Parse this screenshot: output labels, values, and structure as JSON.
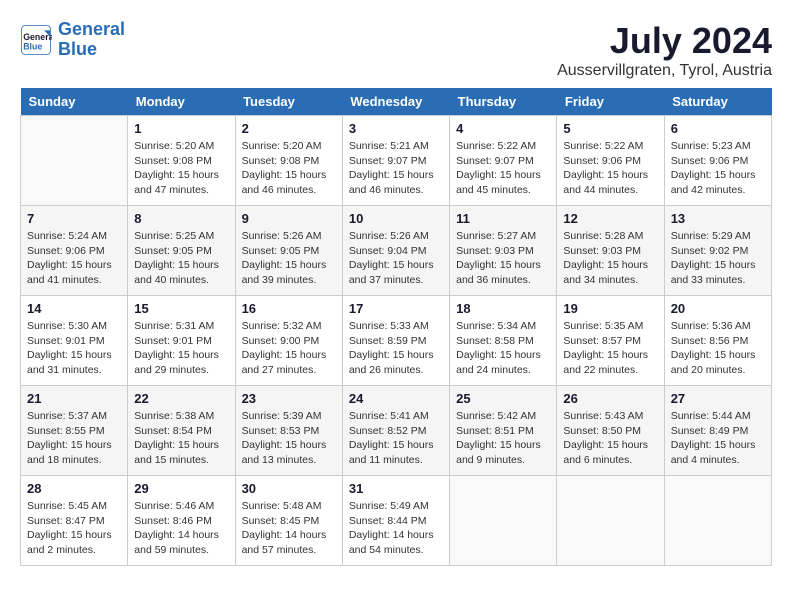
{
  "header": {
    "logo_line1": "General",
    "logo_line2": "Blue",
    "month": "July 2024",
    "location": "Ausservillgraten, Tyrol, Austria"
  },
  "weekdays": [
    "Sunday",
    "Monday",
    "Tuesday",
    "Wednesday",
    "Thursday",
    "Friday",
    "Saturday"
  ],
  "weeks": [
    [
      {
        "day": "",
        "info": ""
      },
      {
        "day": "1",
        "info": "Sunrise: 5:20 AM\nSunset: 9:08 PM\nDaylight: 15 hours\nand 47 minutes."
      },
      {
        "day": "2",
        "info": "Sunrise: 5:20 AM\nSunset: 9:08 PM\nDaylight: 15 hours\nand 46 minutes."
      },
      {
        "day": "3",
        "info": "Sunrise: 5:21 AM\nSunset: 9:07 PM\nDaylight: 15 hours\nand 46 minutes."
      },
      {
        "day": "4",
        "info": "Sunrise: 5:22 AM\nSunset: 9:07 PM\nDaylight: 15 hours\nand 45 minutes."
      },
      {
        "day": "5",
        "info": "Sunrise: 5:22 AM\nSunset: 9:06 PM\nDaylight: 15 hours\nand 44 minutes."
      },
      {
        "day": "6",
        "info": "Sunrise: 5:23 AM\nSunset: 9:06 PM\nDaylight: 15 hours\nand 42 minutes."
      }
    ],
    [
      {
        "day": "7",
        "info": "Sunrise: 5:24 AM\nSunset: 9:06 PM\nDaylight: 15 hours\nand 41 minutes."
      },
      {
        "day": "8",
        "info": "Sunrise: 5:25 AM\nSunset: 9:05 PM\nDaylight: 15 hours\nand 40 minutes."
      },
      {
        "day": "9",
        "info": "Sunrise: 5:26 AM\nSunset: 9:05 PM\nDaylight: 15 hours\nand 39 minutes."
      },
      {
        "day": "10",
        "info": "Sunrise: 5:26 AM\nSunset: 9:04 PM\nDaylight: 15 hours\nand 37 minutes."
      },
      {
        "day": "11",
        "info": "Sunrise: 5:27 AM\nSunset: 9:03 PM\nDaylight: 15 hours\nand 36 minutes."
      },
      {
        "day": "12",
        "info": "Sunrise: 5:28 AM\nSunset: 9:03 PM\nDaylight: 15 hours\nand 34 minutes."
      },
      {
        "day": "13",
        "info": "Sunrise: 5:29 AM\nSunset: 9:02 PM\nDaylight: 15 hours\nand 33 minutes."
      }
    ],
    [
      {
        "day": "14",
        "info": "Sunrise: 5:30 AM\nSunset: 9:01 PM\nDaylight: 15 hours\nand 31 minutes."
      },
      {
        "day": "15",
        "info": "Sunrise: 5:31 AM\nSunset: 9:01 PM\nDaylight: 15 hours\nand 29 minutes."
      },
      {
        "day": "16",
        "info": "Sunrise: 5:32 AM\nSunset: 9:00 PM\nDaylight: 15 hours\nand 27 minutes."
      },
      {
        "day": "17",
        "info": "Sunrise: 5:33 AM\nSunset: 8:59 PM\nDaylight: 15 hours\nand 26 minutes."
      },
      {
        "day": "18",
        "info": "Sunrise: 5:34 AM\nSunset: 8:58 PM\nDaylight: 15 hours\nand 24 minutes."
      },
      {
        "day": "19",
        "info": "Sunrise: 5:35 AM\nSunset: 8:57 PM\nDaylight: 15 hours\nand 22 minutes."
      },
      {
        "day": "20",
        "info": "Sunrise: 5:36 AM\nSunset: 8:56 PM\nDaylight: 15 hours\nand 20 minutes."
      }
    ],
    [
      {
        "day": "21",
        "info": "Sunrise: 5:37 AM\nSunset: 8:55 PM\nDaylight: 15 hours\nand 18 minutes."
      },
      {
        "day": "22",
        "info": "Sunrise: 5:38 AM\nSunset: 8:54 PM\nDaylight: 15 hours\nand 15 minutes."
      },
      {
        "day": "23",
        "info": "Sunrise: 5:39 AM\nSunset: 8:53 PM\nDaylight: 15 hours\nand 13 minutes."
      },
      {
        "day": "24",
        "info": "Sunrise: 5:41 AM\nSunset: 8:52 PM\nDaylight: 15 hours\nand 11 minutes."
      },
      {
        "day": "25",
        "info": "Sunrise: 5:42 AM\nSunset: 8:51 PM\nDaylight: 15 hours\nand 9 minutes."
      },
      {
        "day": "26",
        "info": "Sunrise: 5:43 AM\nSunset: 8:50 PM\nDaylight: 15 hours\nand 6 minutes."
      },
      {
        "day": "27",
        "info": "Sunrise: 5:44 AM\nSunset: 8:49 PM\nDaylight: 15 hours\nand 4 minutes."
      }
    ],
    [
      {
        "day": "28",
        "info": "Sunrise: 5:45 AM\nSunset: 8:47 PM\nDaylight: 15 hours\nand 2 minutes."
      },
      {
        "day": "29",
        "info": "Sunrise: 5:46 AM\nSunset: 8:46 PM\nDaylight: 14 hours\nand 59 minutes."
      },
      {
        "day": "30",
        "info": "Sunrise: 5:48 AM\nSunset: 8:45 PM\nDaylight: 14 hours\nand 57 minutes."
      },
      {
        "day": "31",
        "info": "Sunrise: 5:49 AM\nSunset: 8:44 PM\nDaylight: 14 hours\nand 54 minutes."
      },
      {
        "day": "",
        "info": ""
      },
      {
        "day": "",
        "info": ""
      },
      {
        "day": "",
        "info": ""
      }
    ]
  ]
}
